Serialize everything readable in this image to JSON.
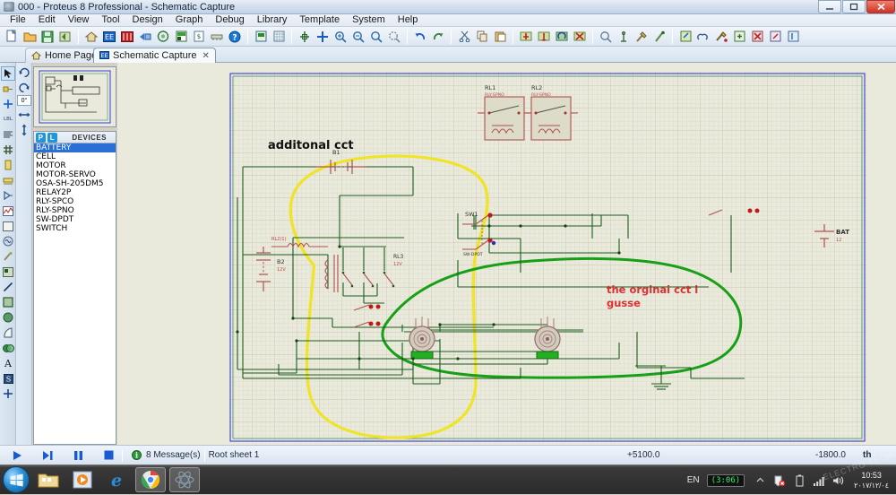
{
  "window": {
    "title": "000 - Proteus 8 Professional - Schematic Capture",
    "app_icon": "proteus-icon",
    "minimize": "—",
    "maximize": "□",
    "close": "✕"
  },
  "menubar": {
    "items": [
      {
        "label": "File"
      },
      {
        "label": "Edit"
      },
      {
        "label": "View"
      },
      {
        "label": "Tool"
      },
      {
        "label": "Design"
      },
      {
        "label": "Graph"
      },
      {
        "label": "Debug"
      },
      {
        "label": "Library"
      },
      {
        "label": "Template"
      },
      {
        "label": "System"
      },
      {
        "label": "Help"
      }
    ]
  },
  "toolbar": {
    "groups": [
      [
        "new-file-icon",
        "open-file-icon",
        "save-file-icon",
        "import-icon"
      ],
      [
        "home-icon",
        "schematic-capture-icon",
        "pcb-layout-icon",
        "3d-viewer-icon",
        "bill-of-materials-icon",
        "source-code-icon",
        "design-explorer-icon",
        "vsm-icon",
        "help-icon"
      ],
      [
        "print-icon",
        "grid-icon",
        "origin-icon"
      ],
      [
        "center-icon",
        "zoom-in-icon",
        "zoom-out-icon",
        "zoom-all-icon",
        "zoom-area-icon"
      ],
      [
        "undo-icon",
        "redo-icon"
      ],
      [
        "cut-icon",
        "copy-icon",
        "paste-icon"
      ],
      [
        "block-copy-icon",
        "block-move-icon",
        "block-rotate-icon",
        "block-delete-icon"
      ],
      [
        "pick-device-icon",
        "make-device-icon",
        "packaging-tool-icon",
        "decompose-icon"
      ],
      [
        "new-sheet-icon",
        "search-tag-icon",
        "property-assign-icon",
        "zoom-sheet-icon",
        "remove-sheet-icon",
        "goto-sheet-icon",
        "exit-sheet-icon"
      ]
    ]
  },
  "tabs": [
    {
      "label": "Home Page",
      "icon": "home-icon",
      "active": false,
      "close": "✕"
    },
    {
      "label": "Schematic Capture",
      "icon": "schematic-icon",
      "active": true,
      "close": "✕"
    }
  ],
  "modebar": {
    "items": [
      {
        "name": "selection-mode",
        "glyph": "➤",
        "selected": true
      },
      {
        "name": "component-mode",
        "glyph": "⇨"
      },
      {
        "name": "junction-dot-mode",
        "glyph": "✚"
      },
      {
        "name": "wire-label-mode",
        "glyph": "LBL"
      },
      {
        "name": "text-script-mode",
        "glyph": "≡"
      },
      {
        "name": "buses-mode",
        "glyph": "╋"
      },
      {
        "name": "subcircuit-mode",
        "glyph": "▮"
      },
      {
        "name": "terminals-mode",
        "glyph": "▔"
      },
      {
        "name": "device-pins-mode",
        "glyph": "▷"
      },
      {
        "name": "graph-mode",
        "glyph": "⌇"
      },
      {
        "name": "tape-recorder-mode",
        "glyph": "□"
      },
      {
        "name": "generator-mode",
        "glyph": "◎"
      },
      {
        "name": "voltage-probe-mode",
        "glyph": "✒"
      },
      {
        "name": "virtual-instrument-mode",
        "glyph": "▣"
      },
      {
        "name": "line-tool",
        "glyph": "╱"
      },
      {
        "name": "box-tool",
        "glyph": "■"
      },
      {
        "name": "circle-tool",
        "glyph": "●"
      },
      {
        "name": "arc-tool",
        "glyph": "◝"
      },
      {
        "name": "path-tool",
        "glyph": "◐"
      },
      {
        "name": "text-tool",
        "glyph": "A"
      },
      {
        "name": "symbol-tool",
        "glyph": "▤"
      },
      {
        "name": "marker-tool",
        "glyph": "✚"
      }
    ]
  },
  "rotation": {
    "rotate_cw": "↻",
    "rotate_ccw": "↺",
    "angle_value": "0°",
    "mirror_horizontal": "↔",
    "mirror_vertical": "↕"
  },
  "devices_panel": {
    "header": "DEVICES",
    "badge_p": "P",
    "badge_l": "L",
    "items": [
      {
        "label": "BATTERY",
        "selected": true
      },
      {
        "label": "CELL",
        "selected": false
      },
      {
        "label": "MOTOR",
        "selected": false
      },
      {
        "label": "MOTOR-SERVO",
        "selected": false
      },
      {
        "label": "OSA-SH-205DM5",
        "selected": false
      },
      {
        "label": "RELAY2P",
        "selected": false
      },
      {
        "label": "RLY-SPCO",
        "selected": false
      },
      {
        "label": "RLY-SPNO",
        "selected": false
      },
      {
        "label": "SW-DPDT",
        "selected": false
      },
      {
        "label": "SWITCH",
        "selected": false
      }
    ]
  },
  "schematic": {
    "annotations": [
      {
        "name": "annotation-additonal-cct",
        "text": "additonal cct",
        "color": "#000000"
      },
      {
        "name": "annotation-original-cct",
        "text": "the orginal cct i",
        "color": "#e03030"
      },
      {
        "name": "annotation-original-cct-2",
        "text": "gusse",
        "color": "#e03030"
      }
    ],
    "components": [
      {
        "ref": "B1",
        "value": "",
        "type": "battery"
      },
      {
        "ref": "B2",
        "value": "12V",
        "type": "battery"
      },
      {
        "ref": "RL1",
        "value": "RLY-SPNO",
        "type": "relay"
      },
      {
        "ref": "RL2",
        "value": "RLY-SPNO",
        "type": "relay"
      },
      {
        "ref": "RL3",
        "value": "12V",
        "type": "relay"
      },
      {
        "ref": "SW1",
        "value": "SW-DPDT",
        "type": "switch"
      },
      {
        "ref": "BAT",
        "value": "12",
        "type": "battery"
      },
      {
        "ref": "RL2(1)",
        "value": "",
        "type": "relay-contact"
      }
    ],
    "highlight_loops": [
      {
        "name": "yellow-loop",
        "color": "#f2e735"
      },
      {
        "name": "green-loop",
        "color": "#17a017"
      }
    ]
  },
  "statusbar": {
    "play": "▶",
    "step": "▶❙",
    "pause": "❙❙",
    "stop": "■",
    "messages": "8 Message(s)",
    "sheet": "Root sheet 1",
    "coord_x": "+5100.0",
    "coord_y": "-1800.0",
    "units": "th"
  },
  "taskbar": {
    "start": "start-orb",
    "items": [
      {
        "name": "explorer-icon",
        "active": false
      },
      {
        "name": "media-player-icon",
        "active": false
      },
      {
        "name": "internet-explorer-icon",
        "active": false
      },
      {
        "name": "chrome-icon",
        "active": true
      },
      {
        "name": "proteus-icon",
        "active": true
      }
    ],
    "tray": {
      "language": "EN",
      "battery_time": "(3:06)",
      "icons": [
        "show-hidden-icon",
        "security-alert-icon",
        "battery-icon",
        "network-icon",
        "volume-icon"
      ],
      "time": "10:53",
      "date": "٢٠١٧/١٢/٠٤"
    }
  },
  "watermark": "ELECTRO TECH"
}
